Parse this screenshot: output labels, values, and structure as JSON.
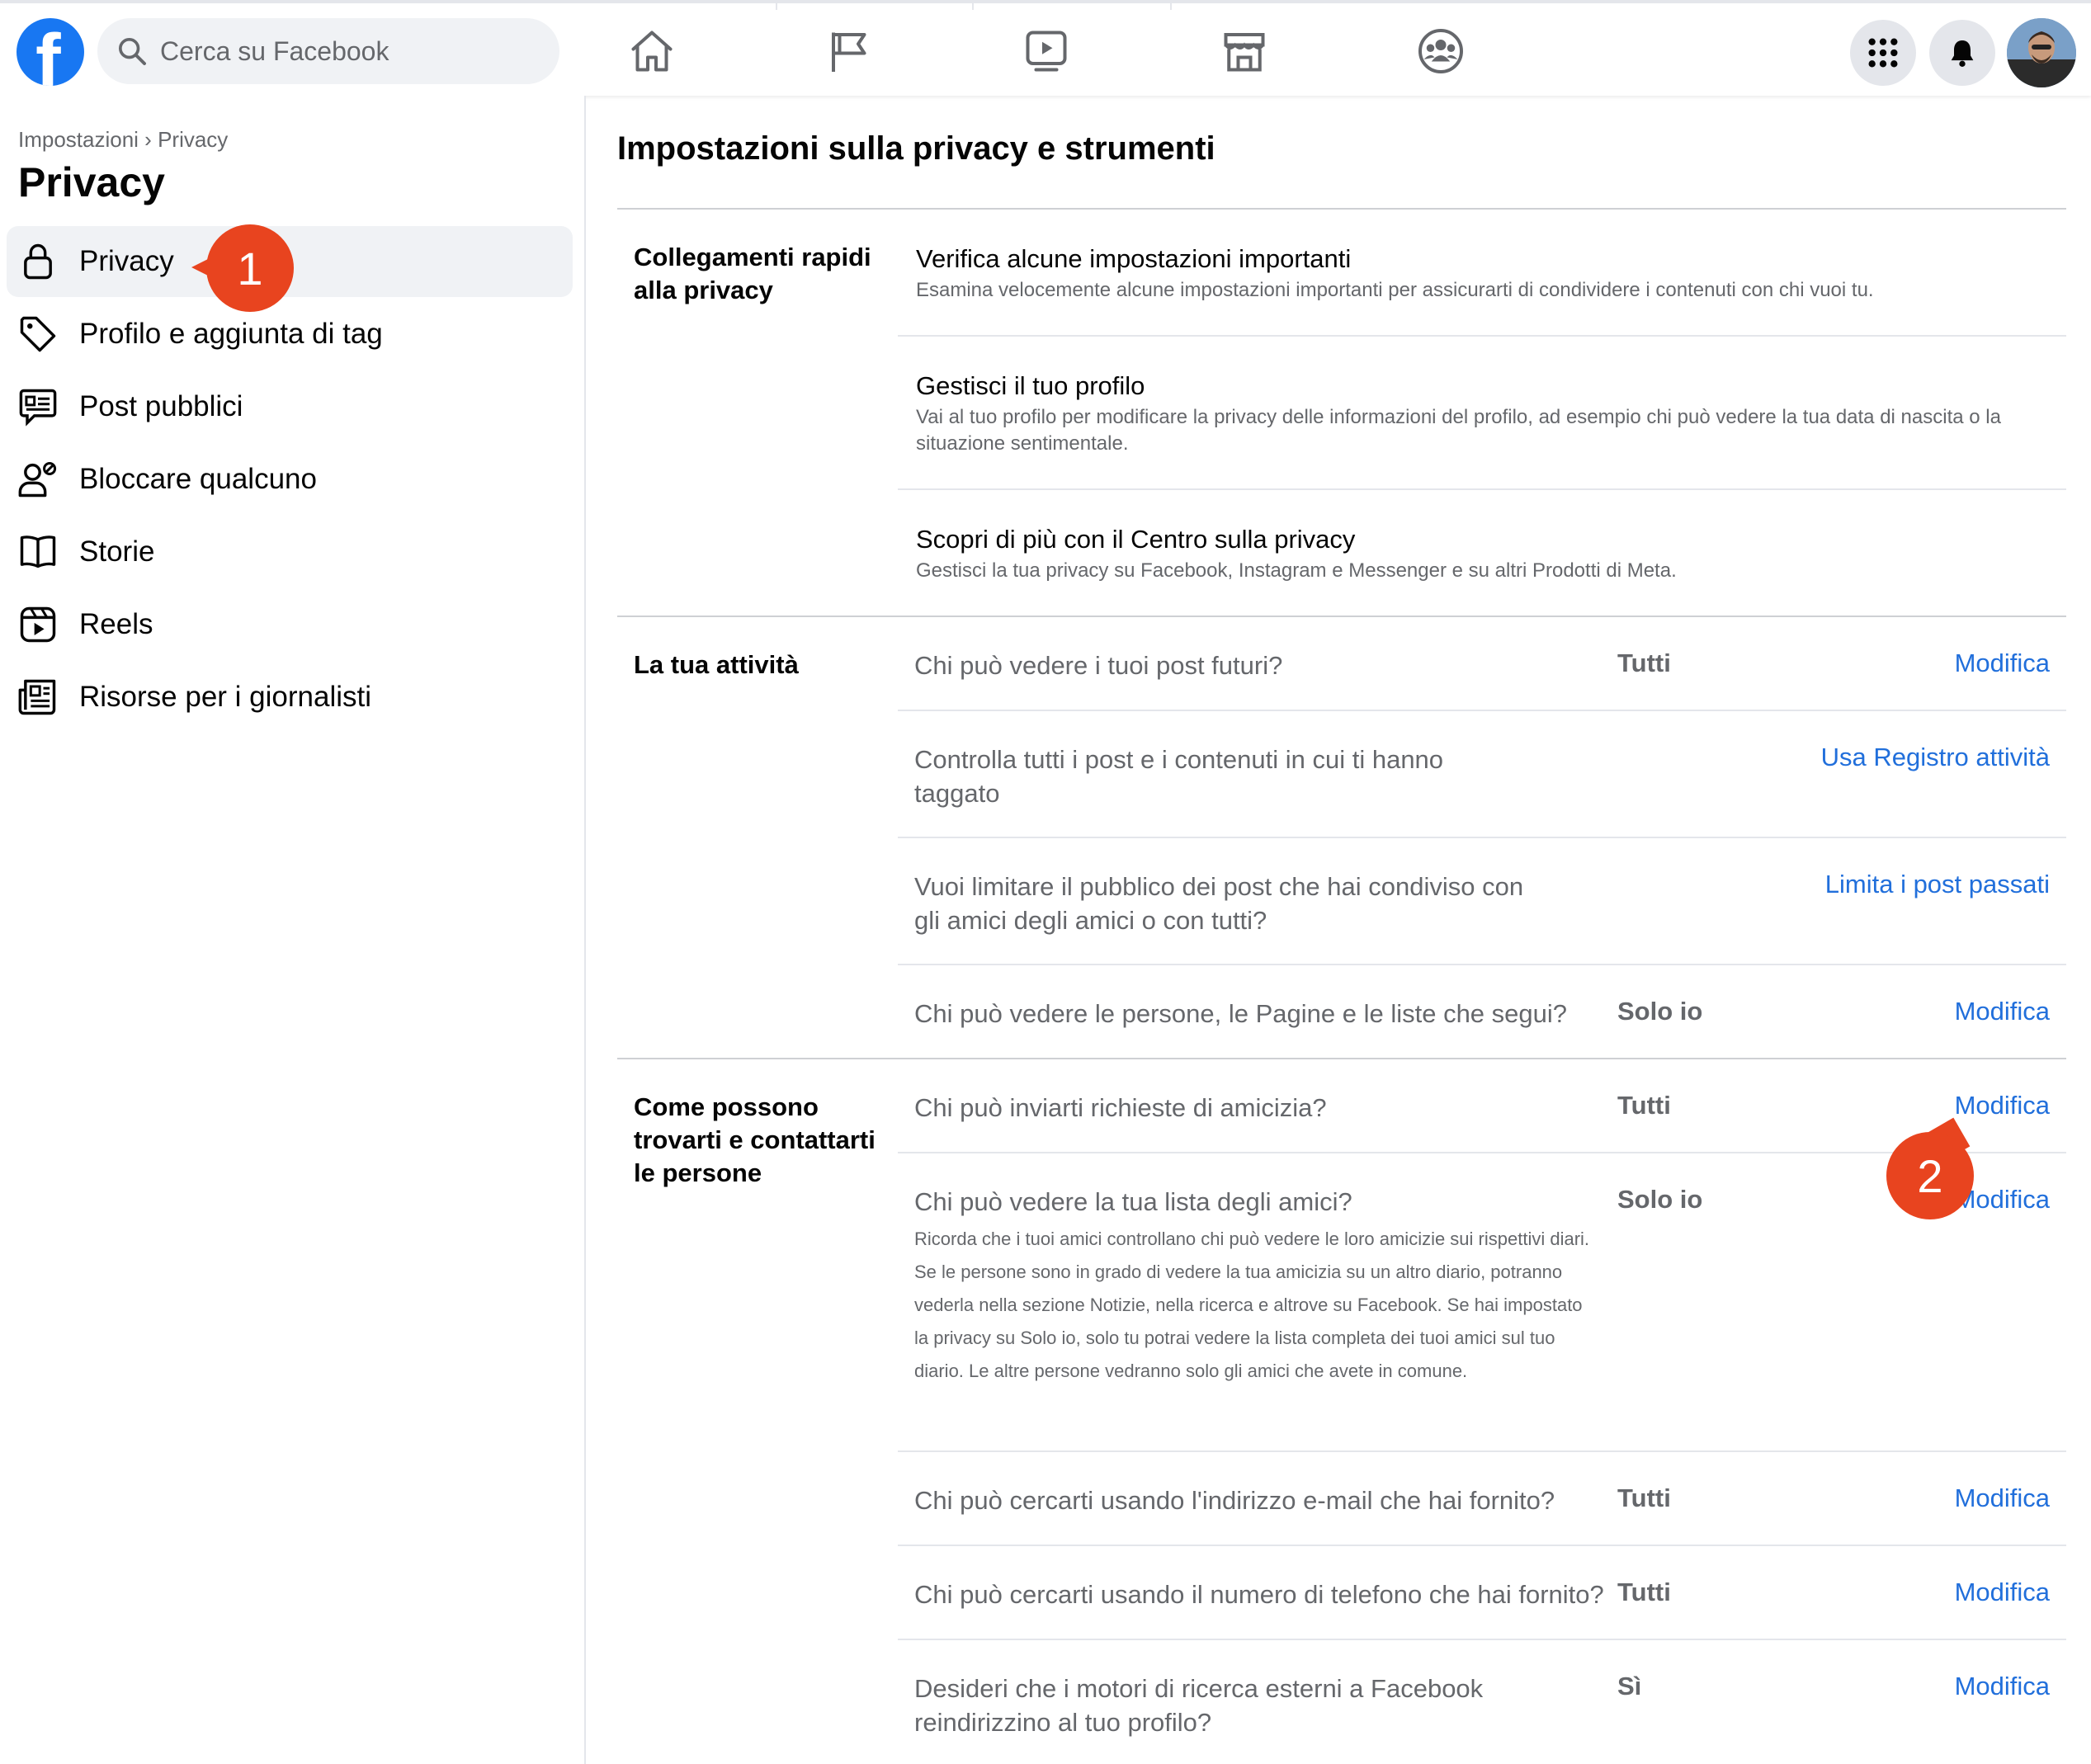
{
  "topbar": {
    "logo": "f",
    "search_placeholder": "Cerca su Facebook",
    "nav_icons": [
      "home-icon",
      "flag-icon",
      "video-icon",
      "marketplace-icon",
      "groups-icon"
    ],
    "right_icons": [
      "menu-grid-icon",
      "notifications-bell-icon"
    ],
    "brand_color": "#1877f2"
  },
  "sidebar": {
    "breadcrumb": "Impostazioni › Privacy",
    "title": "Privacy",
    "items": [
      {
        "label": "Privacy",
        "icon": "lock-icon",
        "active": true
      },
      {
        "label": "Profilo e aggiunta di tag",
        "icon": "tag-icon"
      },
      {
        "label": "Post pubblici",
        "icon": "public-post-icon"
      },
      {
        "label": "Bloccare qualcuno",
        "icon": "block-user-icon"
      },
      {
        "label": "Storie",
        "icon": "book-icon"
      },
      {
        "label": "Reels",
        "icon": "reels-icon"
      },
      {
        "label": "Risorse per i giornalisti",
        "icon": "newspaper-icon"
      }
    ]
  },
  "markers": {
    "one": "1",
    "two": "2",
    "color": "#e8441f"
  },
  "main": {
    "title": "Impostazioni sulla privacy e strumenti",
    "quick_links": {
      "label": "Collegamenti rapidi alla privacy",
      "items": [
        {
          "title": "Verifica alcune impostazioni importanti",
          "desc": "Esamina velocemente alcune impostazioni importanti per assicurarti di condividere i contenuti con chi vuoi tu."
        },
        {
          "title": "Gestisci il tuo profilo",
          "desc": "Vai al tuo profilo per modificare la privacy delle informazioni del profilo, ad esempio chi può vedere la tua data di nascita o la situazione sentimentale."
        },
        {
          "title": "Scopri di più con il Centro sulla privacy",
          "desc": "Gestisci la tua privacy su Facebook, Instagram e Messenger e su altri Prodotti di Meta."
        }
      ]
    },
    "activity": {
      "label": "La tua attività",
      "rows": [
        {
          "question": "Chi può vedere i tuoi post futuri?",
          "value": "Tutti",
          "action": "Modifica"
        },
        {
          "question": "Controlla tutti i post e i contenuti in cui ti hanno taggato",
          "value": "",
          "action": "Usa Registro attività"
        },
        {
          "question": "Vuoi limitare il pubblico dei post che hai condiviso con gli amici degli amici o con tutti?",
          "value": "",
          "action": "Limita i post passati"
        },
        {
          "question": "Chi può vedere le persone, le Pagine e le liste che segui?",
          "value": "Solo io",
          "action": "Modifica"
        }
      ]
    },
    "contact": {
      "label": "Come possono trovarti e contattarti le persone",
      "rows": [
        {
          "question": "Chi può inviarti richieste di amicizia?",
          "value": "Tutti",
          "action": "Modifica"
        },
        {
          "question": "Chi può vedere la tua lista degli amici?",
          "value": "Solo io",
          "action": "Modifica",
          "note": "Ricorda che i tuoi amici controllano chi può vedere le loro amicizie sui rispettivi diari. Se le persone sono in grado di vedere la tua amicizia su un altro diario, potranno vederla nella sezione Notizie, nella ricerca e altrove su Facebook. Se hai impostato la privacy su Solo io, solo tu potrai vedere la lista completa dei tuoi amici sul tuo diario. Le altre persone vedranno solo gli amici che avete in comune."
        },
        {
          "question": "Chi può cercarti usando l'indirizzo e-mail che hai fornito?",
          "value": "Tutti",
          "action": "Modifica"
        },
        {
          "question": "Chi può cercarti usando il numero di telefono che hai fornito?",
          "value": "Tutti",
          "action": "Modifica"
        },
        {
          "question": "Desideri che i motori di ricerca esterni a Facebook reindirizzino al tuo profilo?",
          "value": "Sì",
          "action": "Modifica"
        }
      ]
    }
  }
}
